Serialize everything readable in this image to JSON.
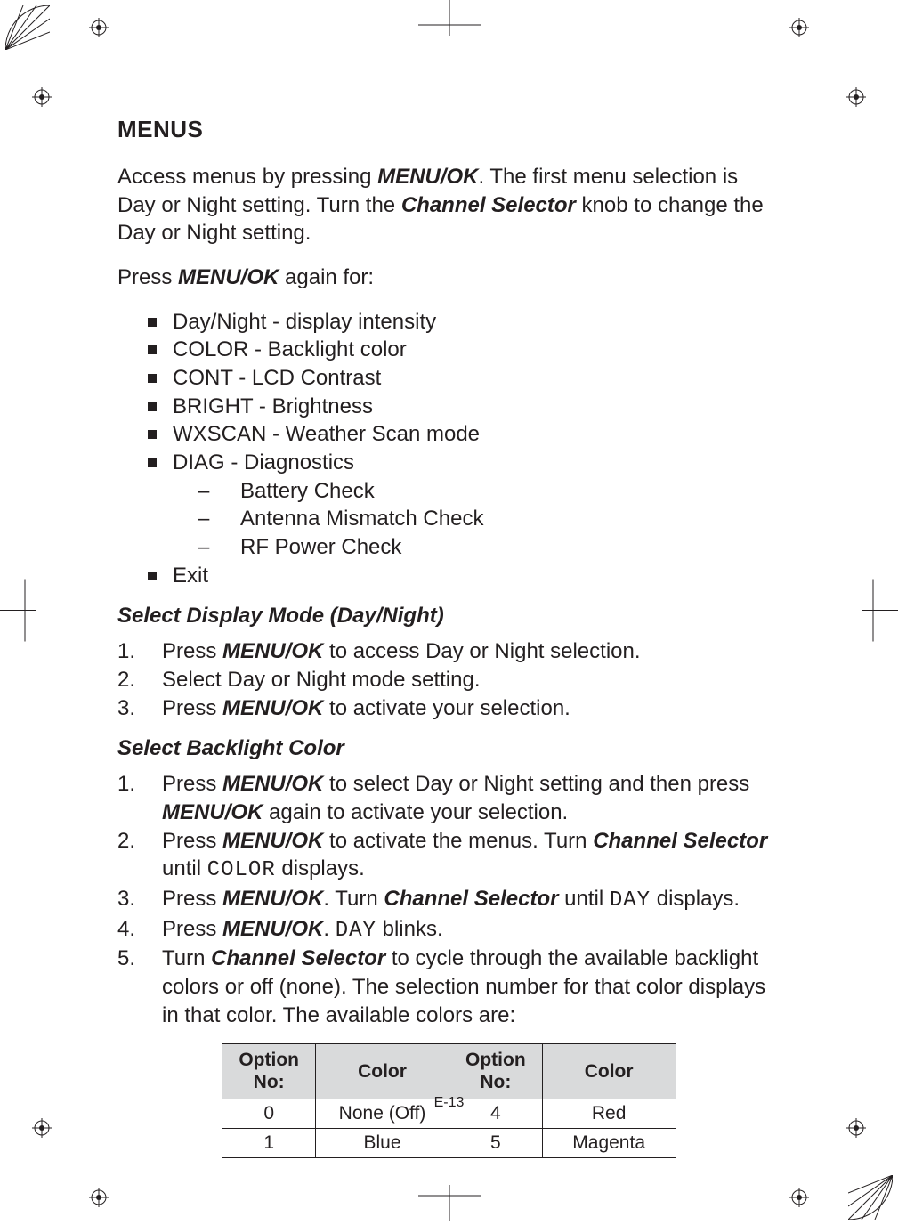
{
  "page_number": "E-13",
  "heading": "MENUS",
  "intro": {
    "pre1": "Access menus by pressing ",
    "b1": "MENU/OK",
    "mid1": ". The first menu selection is Day or Night setting.  Turn the ",
    "b2": "Channel Selector",
    "post1": " knob to change the Day or Night setting."
  },
  "press_again": {
    "pre": "Press ",
    "b": "MENU/OK",
    "post": " again for:"
  },
  "menu_items": [
    "Day/Night - display intensity",
    "COLOR - Backlight color",
    "CONT - LCD Contrast",
    "BRIGHT - Brightness",
    "WXSCAN - Weather Scan mode",
    "DIAG - Diagnostics",
    "Exit"
  ],
  "diag_sub": [
    "Battery Check",
    "Antenna Mismatch Check",
    "RF Power Check"
  ],
  "sub1_title": "Select Display Mode (Day/Night)",
  "sub1_steps": {
    "s1": {
      "pre": "Press ",
      "b": "MENU/OK",
      "post": " to access Day or Night selection."
    },
    "s2": {
      "t": "Select Day or Night mode setting."
    },
    "s3": {
      "pre": "Press ",
      "b": "MENU/OK",
      "post": "  to activate your selection."
    }
  },
  "sub2_title": "Select Backlight Color",
  "sub2_steps": {
    "s1": {
      "pre": "Press ",
      "b1": "MENU/OK",
      "mid": " to select Day or Night setting and then press ",
      "b2": "MENU/OK",
      "post": "  again to activate your selection."
    },
    "s2": {
      "pre": "Press ",
      "b1": "MENU/OK",
      "mid": " to activate the menus. Turn ",
      "b2": "Channel Selector",
      "post_pre": " until ",
      "lcd": "COLOR",
      "post": " displays."
    },
    "s3": {
      "pre": "Press ",
      "b1": "MENU/OK",
      "mid": ". Turn ",
      "b2": "Channel Selector",
      "post_pre": " until ",
      "lcd": "DAY",
      "post": " displays."
    },
    "s4": {
      "pre": "Press ",
      "b1": "MENU/OK",
      "mid": ". ",
      "lcd": "DAY",
      "post": " blinks."
    },
    "s5": {
      "pre": "Turn ",
      "b1": "Channel Selector",
      "post": " to cycle through the available backlight colors or off (none). The selection number for that color displays in that color. The available colors are:"
    }
  },
  "table": {
    "headers": {
      "opt": "Option No:",
      "color": "Color"
    },
    "rows": [
      {
        "o1": "0",
        "c1": "None (Off)",
        "o2": "4",
        "c2": "Red"
      },
      {
        "o1": "1",
        "c1": "Blue",
        "o2": "5",
        "c2": "Magenta"
      }
    ]
  }
}
